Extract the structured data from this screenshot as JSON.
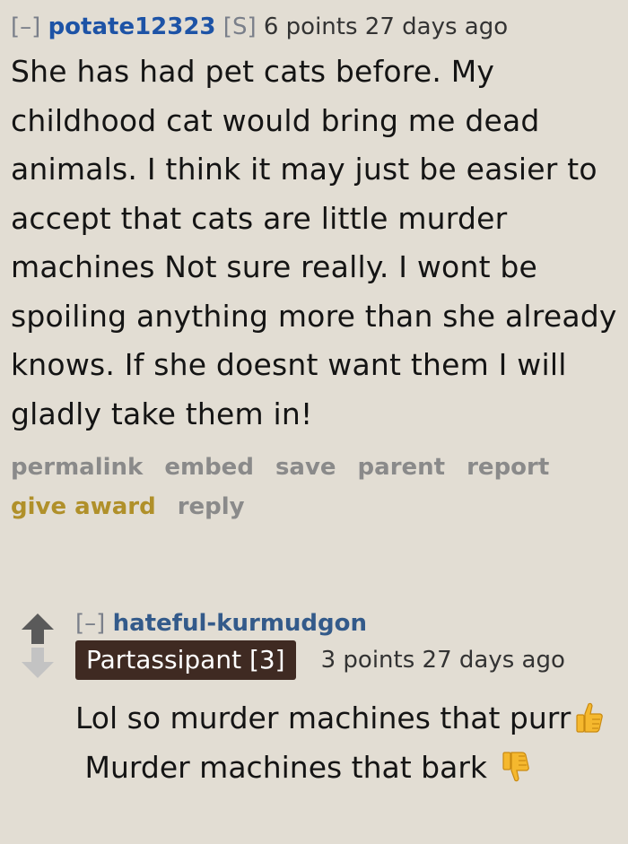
{
  "comment": {
    "collapse": "[–]",
    "author": "potate12323",
    "submitter_tag": "[S]",
    "score_time": "6 points 27 days ago",
    "body": "She has had pet cats before. My childhood cat would bring me dead animals. I think it may just be easier to accept that cats are little murder machines Not sure really. I wont be spoiling anything more than she already knows. If she doesnt want them I will gladly take them in!",
    "buttons": {
      "permalink": "permalink",
      "embed": "embed",
      "save": "save",
      "parent": "parent",
      "report": "report",
      "give_award": "give award",
      "reply": "reply"
    }
  },
  "reply": {
    "collapse": "[–]",
    "author": "hateful-kurmudgon",
    "flair": "Partassipant [3]",
    "score_time": "3 points 27 days ago",
    "body_part1": "Lol so murder machines that purr",
    "body_part2": "Murder machines that bark",
    "icons": {
      "upvote": "arrow-up-icon",
      "downvote": "arrow-down-icon",
      "thumbs_up": "thumbs-up-icon",
      "thumbs_down": "thumbs-down-icon"
    }
  },
  "colors": {
    "background": "#e2ddd3",
    "author_link": "#1d53a6",
    "award": "#b0902a",
    "flair_bg": "#3f2a22",
    "emoji": "#f5b82e"
  }
}
